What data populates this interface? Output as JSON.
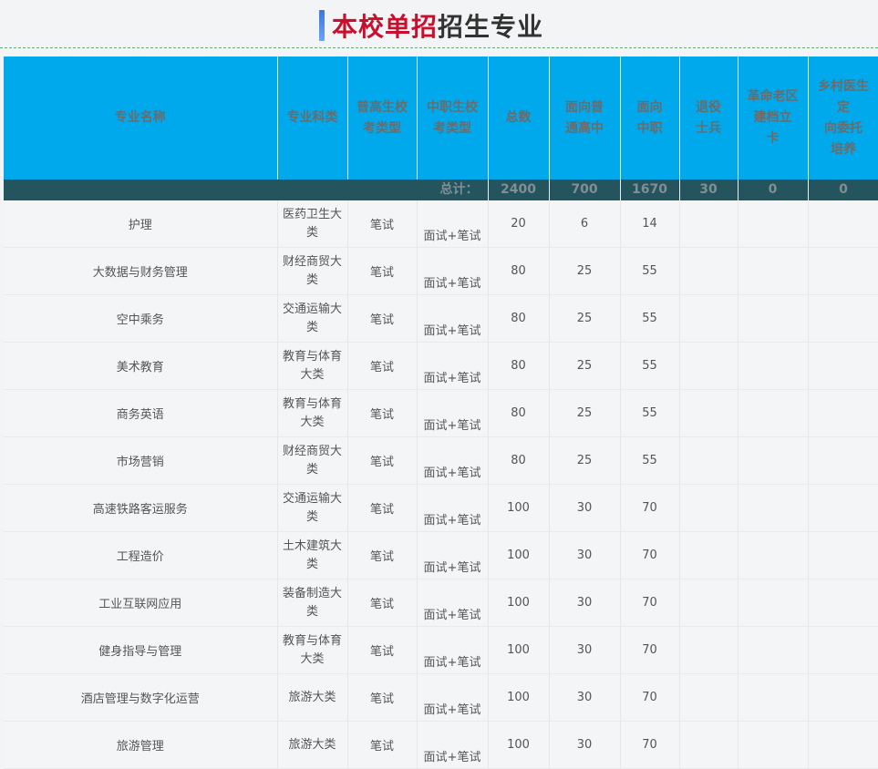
{
  "title": {
    "red": "本校单招",
    "dark": "招生专业"
  },
  "headers": [
    "专业名称",
    "专业科类",
    "普高生校考类型",
    "中职生校考类型",
    "总数",
    "面向普通高中",
    "面向中职",
    "退役士兵",
    "革命老区建档立卡",
    "乡村医生定向委托培养"
  ],
  "header_lines": [
    [
      "专业名称"
    ],
    [
      "专业科类"
    ],
    [
      "普高生校",
      "考类型"
    ],
    [
      "中职生校",
      "考类型"
    ],
    [
      "总数"
    ],
    [
      "面向普",
      "通高中"
    ],
    [
      "面向",
      "中职"
    ],
    [
      "退役",
      "士兵"
    ],
    [
      "革命老区",
      "建档立",
      "卡"
    ],
    [
      "乡村医生",
      "定",
      "向委托",
      "培养"
    ]
  ],
  "totals": {
    "label": "总计：",
    "total": "2400",
    "general": "700",
    "vocational": "1670",
    "veterans": "30",
    "old_area": "0",
    "village_doctor": "0"
  },
  "rows": [
    {
      "name": "护理",
      "category": [
        "医药卫生大",
        "类"
      ],
      "general_exam": "笔试",
      "vocational_exam": "面试+笔试",
      "total": "20",
      "general": "6",
      "vocational": "14"
    },
    {
      "name": "大数据与财务管理",
      "category": [
        "财经商贸大",
        "类"
      ],
      "general_exam": "笔试",
      "vocational_exam": "面试+笔试",
      "total": "80",
      "general": "25",
      "vocational": "55"
    },
    {
      "name": "空中乘务",
      "category": [
        "交通运输大",
        "类"
      ],
      "general_exam": "笔试",
      "vocational_exam": "面试+笔试",
      "total": "80",
      "general": "25",
      "vocational": "55"
    },
    {
      "name": "美术教育",
      "category": [
        "教育与体育",
        "大类"
      ],
      "general_exam": "笔试",
      "vocational_exam": "面试+笔试",
      "total": "80",
      "general": "25",
      "vocational": "55"
    },
    {
      "name": "商务英语",
      "category": [
        "教育与体育",
        "大类"
      ],
      "general_exam": "笔试",
      "vocational_exam": "面试+笔试",
      "total": "80",
      "general": "25",
      "vocational": "55"
    },
    {
      "name": "市场营销",
      "category": [
        "财经商贸大",
        "类"
      ],
      "general_exam": "笔试",
      "vocational_exam": "面试+笔试",
      "total": "80",
      "general": "25",
      "vocational": "55"
    },
    {
      "name": "高速铁路客运服务",
      "category": [
        "交通运输大",
        "类"
      ],
      "general_exam": "笔试",
      "vocational_exam": "面试+笔试",
      "total": "100",
      "general": "30",
      "vocational": "70"
    },
    {
      "name": "工程造价",
      "category": [
        "土木建筑大",
        "类"
      ],
      "general_exam": "笔试",
      "vocational_exam": "面试+笔试",
      "total": "100",
      "general": "30",
      "vocational": "70"
    },
    {
      "name": "工业互联网应用",
      "category": [
        "装备制造大",
        "类"
      ],
      "general_exam": "笔试",
      "vocational_exam": "面试+笔试",
      "total": "100",
      "general": "30",
      "vocational": "70"
    },
    {
      "name": "健身指导与管理",
      "category": [
        "教育与体育",
        "大类"
      ],
      "general_exam": "笔试",
      "vocational_exam": "面试+笔试",
      "total": "100",
      "general": "30",
      "vocational": "70"
    },
    {
      "name": "酒店管理与数字化运营",
      "category": [
        "旅游大类"
      ],
      "general_exam": "笔试",
      "vocational_exam": "面试+笔试",
      "total": "100",
      "general": "30",
      "vocational": "70"
    },
    {
      "name": "旅游管理",
      "category": [
        "旅游大类"
      ],
      "general_exam": "笔试",
      "vocational_exam": "面试+笔试",
      "total": "100",
      "general": "30",
      "vocational": "70"
    }
  ],
  "colors": {
    "header_bg": "#00a9ec",
    "total_bg": "#24555e",
    "title_red": "#c8102e",
    "title_bar": "#3a78e0"
  }
}
